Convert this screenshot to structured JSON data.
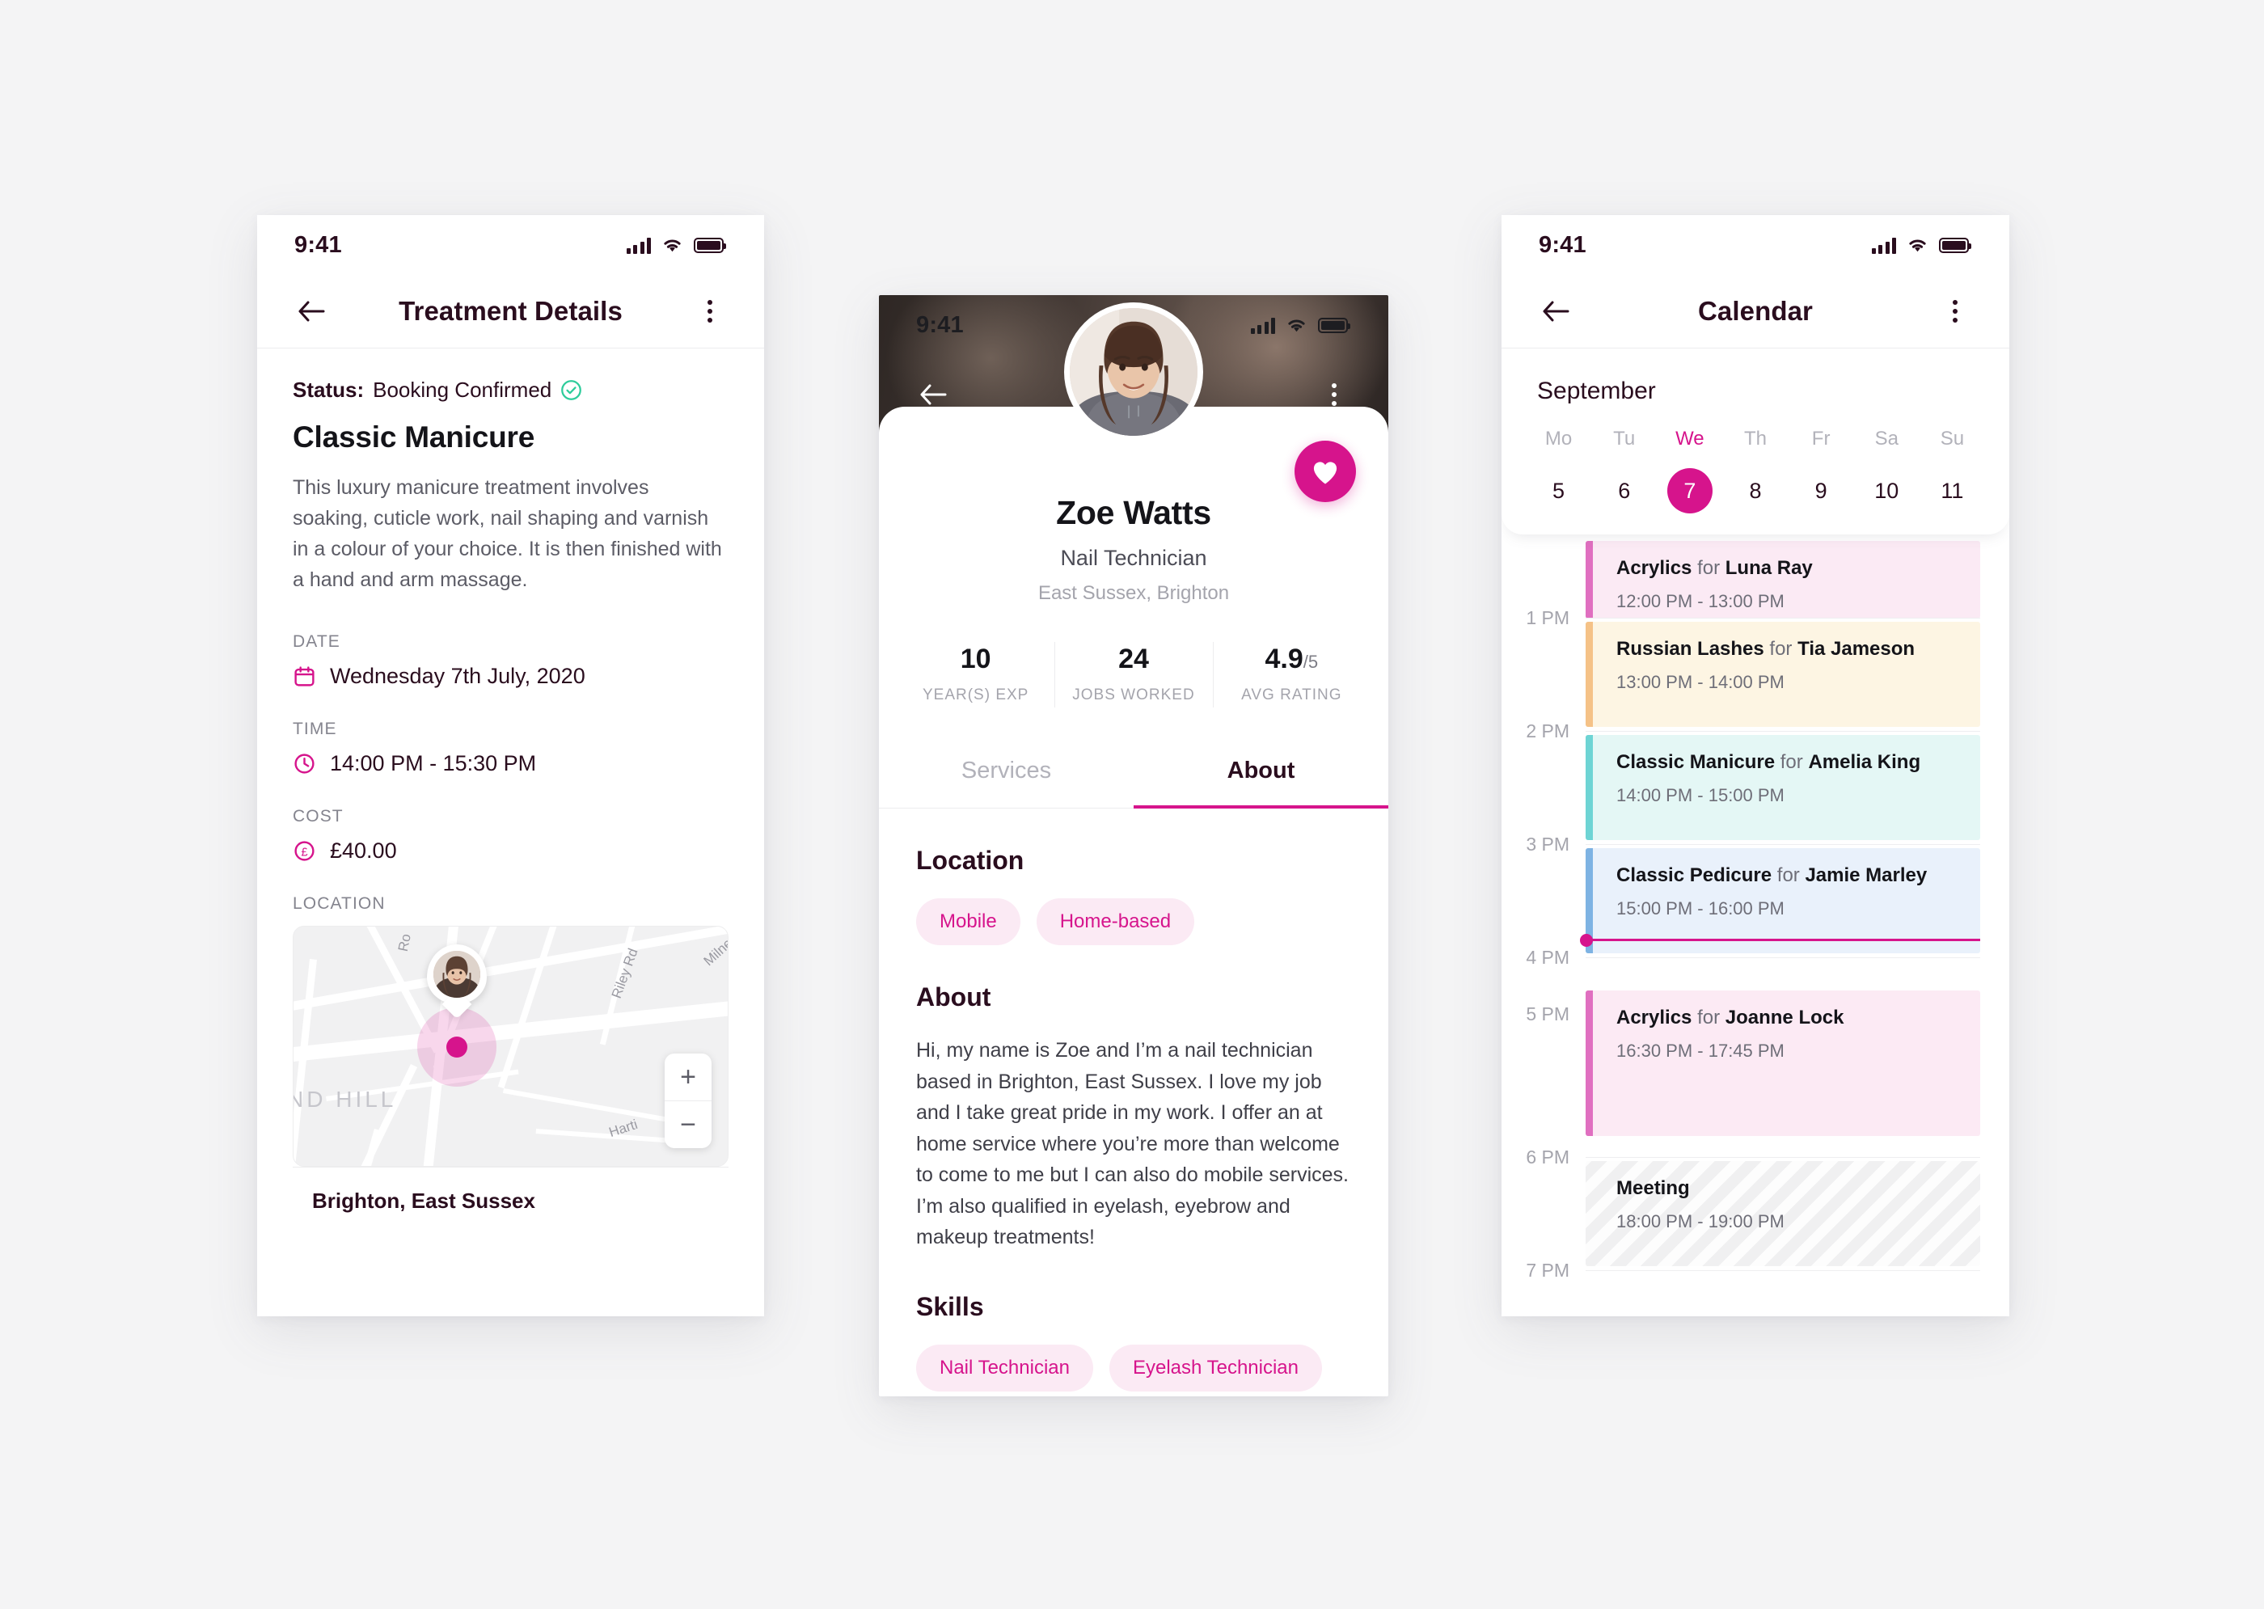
{
  "theme": {
    "accent": "#D6148C",
    "ink": "#2a0d1e",
    "muted": "#a4a4ac",
    "success": "#2ecc9b"
  },
  "screen_treatment": {
    "status_bar": {
      "time": "9:41"
    },
    "nav": {
      "title": "Treatment Details",
      "back_icon": "arrow-left-icon",
      "more_icon": "kebab-menu-icon"
    },
    "status": {
      "label": "Status:",
      "value": "Booking Confirmed",
      "icon": "check-circle-icon"
    },
    "title": "Classic Manicure",
    "description": "This luxury manicure treatment involves soaking, cuticle work, nail shaping and varnish in a colour of your choice. It is then finished with a hand and arm massage.",
    "fields": [
      {
        "label": "DATE",
        "icon": "calendar-icon",
        "value": "Wednesday 7th July, 2020"
      },
      {
        "label": "TIME",
        "icon": "clock-icon",
        "value": "14:00 PM - 15:30 PM"
      },
      {
        "label": "COST",
        "icon": "pound-icon",
        "value": "£40.00"
      }
    ],
    "location_label": "LOCATION",
    "map": {
      "street_labels": [
        "Ro",
        "Riley Rd",
        "Milne",
        "Harti",
        "ND HILL"
      ],
      "zoom_in": "+",
      "zoom_out": "−",
      "caption": "Brighton, East Sussex"
    }
  },
  "screen_profile": {
    "status_bar": {
      "time": "9:41"
    },
    "nav": {
      "back_icon": "arrow-left-icon",
      "more_icon": "kebab-menu-icon"
    },
    "favourite_icon": "heart-icon",
    "name": "Zoe Watts",
    "role": "Nail Technician",
    "location": "East Sussex, Brighton",
    "stats": [
      {
        "value": "10",
        "suffix": "",
        "label": "YEAR(S) EXP"
      },
      {
        "value": "24",
        "suffix": "",
        "label": "JOBS WORKED"
      },
      {
        "value": "4.9",
        "suffix": "/5",
        "label": "AVG RATING"
      }
    ],
    "tabs": [
      {
        "label": "Services",
        "active": false
      },
      {
        "label": "About",
        "active": true
      }
    ],
    "location_heading": "Location",
    "location_chips": [
      "Mobile",
      "Home-based"
    ],
    "about_heading": "About",
    "about_text": "Hi, my name is Zoe and I’m a nail technician based in Brighton, East Sussex. I love my job and I take great pride in my work. I offer an at home service where you’re more than welcome to come to me but I can also do mobile services. I’m also qualified in eyelash, eyebrow and makeup treatments!",
    "skills_heading": "Skills",
    "skills_chips": [
      "Nail Technician",
      "Eyelash Technician"
    ]
  },
  "screen_calendar": {
    "status_bar": {
      "time": "9:41"
    },
    "nav": {
      "title": "Calendar",
      "back_icon": "arrow-left-icon",
      "more_icon": "kebab-menu-icon"
    },
    "month": "September",
    "weekday_headers": [
      "Mo",
      "Tu",
      "We",
      "Th",
      "Fr",
      "Sa",
      "Su"
    ],
    "selected_weekday": "We",
    "days": [
      "5",
      "6",
      "7",
      "8",
      "9",
      "10",
      "11"
    ],
    "selected_day": "7",
    "hour_labels": [
      "1 PM",
      "2 PM",
      "3 PM",
      "4 PM",
      "5 PM",
      "6 PM",
      "7 PM"
    ],
    "events": [
      {
        "service": "Acrylics",
        "joiner": " for ",
        "client": "Luna Ray",
        "time": "12:00 PM - 13:00 PM",
        "bg": "#FBEAF4",
        "accent": "#E06FC0"
      },
      {
        "service": "Russian Lashes",
        "joiner": " for ",
        "client": "Tia Jameson",
        "time": "13:00 PM - 14:00 PM",
        "bg": "#FDF5E3",
        "accent": "#F5C287"
      },
      {
        "service": "Classic Manicure",
        "joiner": " for ",
        "client": "Amelia King",
        "time": "14:00 PM - 15:00 PM",
        "bg": "#E4F7F5",
        "accent": "#6ED4D4"
      },
      {
        "service": "Classic Pedicure",
        "joiner": " for ",
        "client": "Jamie Marley",
        "time": "15:00 PM - 16:00 PM",
        "bg": "#E9F1FB",
        "accent": "#7EB3E3"
      },
      {
        "service": "Acrylics",
        "joiner": " for ",
        "client": "Joanne Lock",
        "time": "16:30 PM - 17:45 PM",
        "bg": "#FCEAF4",
        "accent": "#E06FC0"
      },
      {
        "service": "Meeting",
        "joiner": "",
        "client": "",
        "time": "18:00 PM - 19:00 PM",
        "bg": "hatch",
        "accent": "transparent"
      }
    ]
  }
}
